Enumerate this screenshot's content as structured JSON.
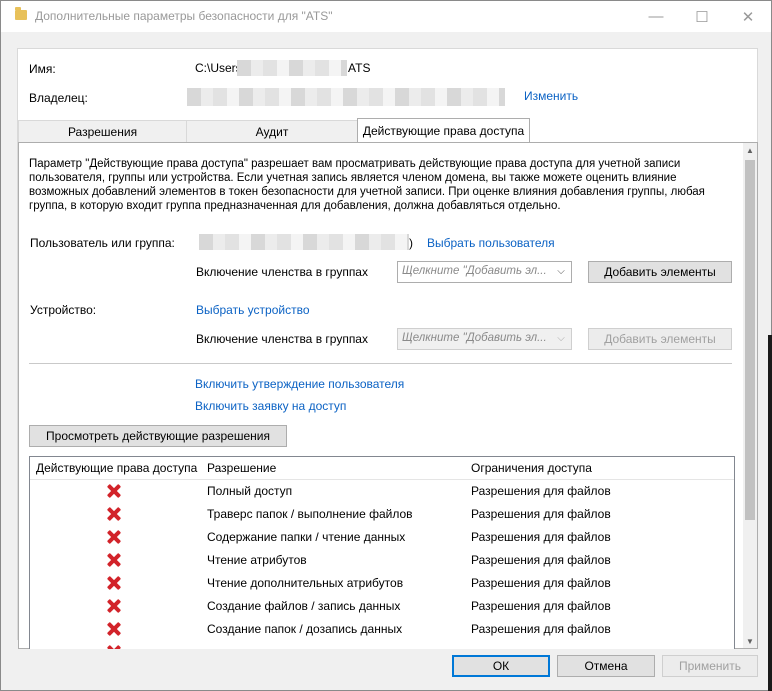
{
  "window": {
    "title": "Дополнительные параметры безопасности  для \"ATS\"",
    "minimize": "—",
    "maximize": "☐",
    "close": "✕"
  },
  "header": {
    "name_label": "Имя:",
    "name_prefix": "C:\\Users",
    "name_suffix": "ATS",
    "owner_label": "Владелец:",
    "change_link": "Изменить"
  },
  "tabs": [
    {
      "label": "Разрешения"
    },
    {
      "label": "Аудит"
    },
    {
      "label": "Действующие права доступа"
    }
  ],
  "panel": {
    "description": "Параметр \"Действующие права доступа\" разрешает вам просматривать действующие права доступа для учетной записи пользователя, группы или устройства. Если учетная запись является членом домена, вы также можете оценить влияние возможных добавлений элементов в токен безопасности для учетной записи. При оценке влияния добавления группы, любая группа, в которую входит группа предназначенная для добавления, должна добавляться отдельно.",
    "user_group_label": "Пользователь или группа:",
    "user_group_suffix": ")",
    "select_user_link": "Выбрать пользователя",
    "membership_label": "Включение членства в группах",
    "combo_placeholder": "Щелкните \"Добавить эл...",
    "add_items_button": "Добавить элементы",
    "device_label": "Устройство:",
    "select_device_link": "Выбрать устройство",
    "enable_user_claim_link": "Включить утверждение пользователя",
    "enable_access_request_link": "Включить заявку на доступ",
    "view_effective_button": "Просмотреть действующие разрешения"
  },
  "table": {
    "headers": [
      "Действующие права доступа",
      "Разрешение",
      "Ограничения доступа"
    ],
    "rows": [
      {
        "permission": "Полный доступ",
        "limit": "Разрешения для файлов"
      },
      {
        "permission": "Траверс папок / выполнение файлов",
        "limit": "Разрешения для файлов"
      },
      {
        "permission": "Содержание папки / чтение данных",
        "limit": "Разрешения для файлов"
      },
      {
        "permission": "Чтение атрибутов",
        "limit": "Разрешения для файлов"
      },
      {
        "permission": "Чтение дополнительных атрибутов",
        "limit": "Разрешения для файлов"
      },
      {
        "permission": "Создание файлов / запись данных",
        "limit": "Разрешения для файлов"
      },
      {
        "permission": "Создание папок / дозапись данных",
        "limit": "Разрешения для файлов"
      }
    ]
  },
  "footer": {
    "ok": "ОК",
    "cancel": "Отмена",
    "apply": "Применить"
  }
}
